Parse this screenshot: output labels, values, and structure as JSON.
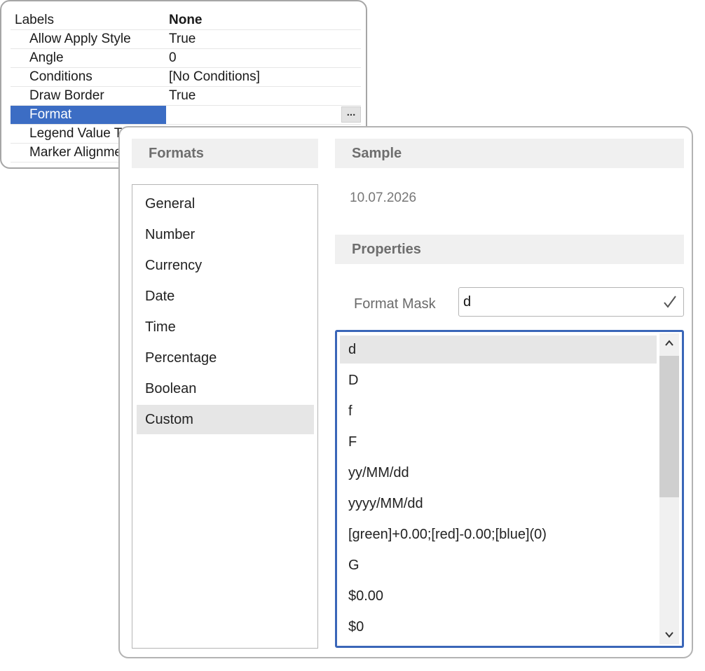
{
  "property_grid": {
    "rows": [
      {
        "name": "Labels",
        "value": "None"
      },
      {
        "name": "Allow Apply Style",
        "value": "True"
      },
      {
        "name": "Angle",
        "value": "0"
      },
      {
        "name": "Conditions",
        "value": "[No Conditions]"
      },
      {
        "name": "Draw Border",
        "value": "True"
      },
      {
        "name": "Format",
        "value": "",
        "button": "..."
      },
      {
        "name": "Legend Value Type",
        "value": ""
      },
      {
        "name": "Marker Alignment",
        "value": ""
      }
    ]
  },
  "dialog": {
    "formats_header": "Formats",
    "sample_header": "Sample",
    "properties_header": "Properties",
    "sample_value": "10.07.2026",
    "format_mask_label": "Format Mask",
    "format_mask_value": "d",
    "formats": [
      "General",
      "Number",
      "Currency",
      "Date",
      "Time",
      "Percentage",
      "Boolean",
      "Custom"
    ],
    "selected_format": "Custom",
    "masks": [
      "d",
      "D",
      "f",
      "F",
      "yy/MM/dd",
      "yyyy/MM/dd",
      "[green]+0.00;[red]-0.00;[blue](0)",
      "G",
      "$0.00",
      "$0"
    ],
    "selected_mask": "d"
  },
  "colors": {
    "selection_blue": "#3c6dc4",
    "list_focus_border": "#3a66b8",
    "header_bg": "#f0f0f0",
    "selected_item_bg": "#e6e6e6"
  },
  "icons": {
    "mask_apply": "checkmark-icon",
    "scroll_up": "chevron-up-icon",
    "scroll_down": "chevron-down-icon"
  }
}
